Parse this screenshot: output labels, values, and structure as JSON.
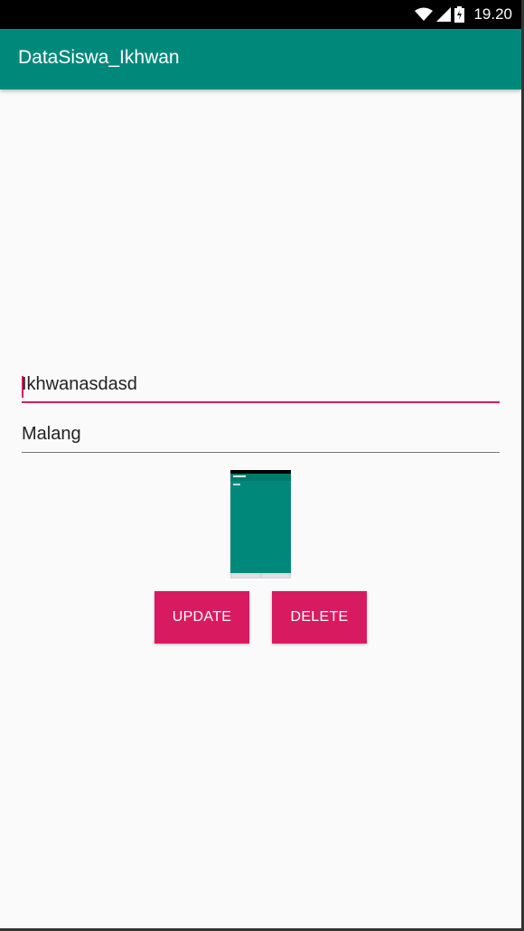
{
  "status_bar": {
    "time": "19.20",
    "icons": [
      "wifi-icon",
      "signal-icon",
      "battery-icon"
    ]
  },
  "app_bar": {
    "title": "DataSiswa_Ikhwan",
    "color": "#00897b"
  },
  "form": {
    "name_value": "Ikhwanasdasd",
    "city_value": "Malang"
  },
  "buttons": {
    "update_label": "UPDATE",
    "delete_label": "DELETE",
    "color": "#d81b60"
  },
  "accent": "#d81b60"
}
